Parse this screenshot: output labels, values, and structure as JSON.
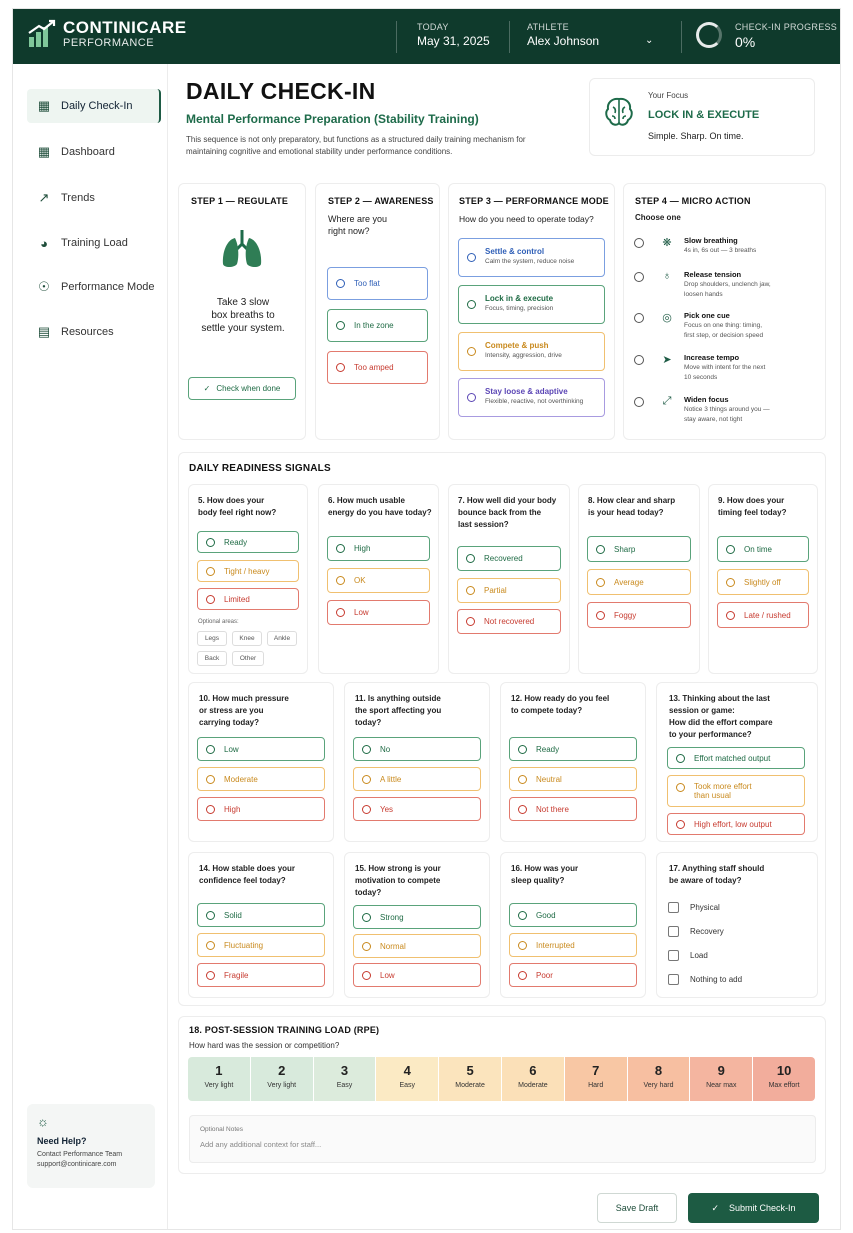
{
  "header": {
    "brand_line1": "CONTINICARE",
    "brand_line2": "PERFORMANCE",
    "today_label": "TODAY",
    "today_value": "May 31, 2025",
    "athlete_label": "ATHLETE",
    "athlete_value": "Alex Johnson",
    "progress_label": "CHECK-IN PROGRESS",
    "progress_value": "0%",
    "progress_fraction": 0
  },
  "sidebar": {
    "items": [
      {
        "label": "Daily Check-In",
        "icon": "checkin-icon"
      },
      {
        "label": "Dashboard",
        "icon": "dashboard-icon"
      },
      {
        "label": "Trends",
        "icon": "trends-icon"
      },
      {
        "label": "Training Load",
        "icon": "training-load-icon"
      },
      {
        "label": "Performance Mode",
        "icon": "performance-mode-icon"
      },
      {
        "label": "Resources",
        "icon": "resources-icon"
      }
    ],
    "help": {
      "title": "Need Help?",
      "line1": "Contact Performance Team",
      "line2": "support@continicare.com"
    }
  },
  "page": {
    "title": "DAILY CHECK-IN",
    "subtitle": "Mental Performance Preparation (Stability Training)",
    "description": "This sequence is not only preparatory, but functions as a structured daily training mechanism for maintaining cognitive and emotional stability under performance conditions."
  },
  "focus": {
    "label": "Your Focus",
    "value": "LOCK IN & EXECUTE",
    "tagline": "Simple. Sharp. On time."
  },
  "step1": {
    "title": "STEP 1 — REGULATE",
    "instruction_1": "Take 3 slow",
    "instruction_2": "box breaths to",
    "instruction_3": "settle your system.",
    "button": "Check when done"
  },
  "step2": {
    "title": "STEP 2 — AWARENESS",
    "question_1": "Where are you",
    "question_2": "right now?",
    "options": [
      "Too flat",
      "In the zone",
      "Too amped"
    ]
  },
  "step3": {
    "title": "STEP 3 — PERFORMANCE MODE",
    "question": "How do you need to operate today?",
    "options": [
      {
        "label": "Settle & control",
        "desc": "Calm the system, reduce noise"
      },
      {
        "label": "Lock in & execute",
        "desc": "Focus, timing, precision"
      },
      {
        "label": "Compete & push",
        "desc": "Intensity, aggression, drive"
      },
      {
        "label": "Stay loose & adaptive",
        "desc": "Flexible, reactive, not overthinking"
      }
    ]
  },
  "step4": {
    "title": "STEP 4 — MICRO ACTION",
    "subtitle": "Choose one",
    "options": [
      {
        "label": "Slow breathing",
        "desc1": "4s in, 6s out — 3 breaths",
        "desc2": "",
        "icon": "breathing-icon"
      },
      {
        "label": "Release tension",
        "desc1": "Drop shoulders, unclench jaw,",
        "desc2": "loosen hands",
        "icon": "release-icon"
      },
      {
        "label": "Pick one cue",
        "desc1": "Focus on one thing: timing,",
        "desc2": "first step, or decision speed",
        "icon": "target-icon"
      },
      {
        "label": "Increase tempo",
        "desc1": "Move with intent for the next",
        "desc2": "10 seconds",
        "icon": "runner-icon"
      },
      {
        "label": "Widen focus",
        "desc1": "Notice 3 things around you —",
        "desc2": "stay aware, not tight",
        "icon": "expand-icon"
      }
    ]
  },
  "readiness": {
    "title": "DAILY READINESS SIGNALS",
    "optional_areas_label": "Optional areas:",
    "areas": [
      "Legs",
      "Knee",
      "Ankle",
      "Back",
      "Other"
    ],
    "questions": [
      {
        "l1": "5. How does your",
        "l2": "body feel right now?",
        "l3": "",
        "options": [
          "Ready",
          "Tight / heavy",
          "Limited"
        ]
      },
      {
        "l1": "6. How much usable",
        "l2": "energy do you have today?",
        "l3": "",
        "options": [
          "High",
          "OK",
          "Low"
        ]
      },
      {
        "l1": "7. How well did your body",
        "l2": "bounce back from the",
        "l3": "last session?",
        "options": [
          "Recovered",
          "Partial",
          "Not recovered"
        ]
      },
      {
        "l1": "8. How clear and sharp",
        "l2": "is your head today?",
        "l3": "",
        "options": [
          "Sharp",
          "Average",
          "Foggy"
        ]
      },
      {
        "l1": "9. How does your",
        "l2": "timing feel today?",
        "l3": "",
        "options": [
          "On time",
          "Slightly off",
          "Late / rushed"
        ]
      },
      {
        "l1": "10. How much pressure",
        "l2": "or stress are you",
        "l3": "carrying today?",
        "options": [
          "Low",
          "Moderate",
          "High"
        ]
      },
      {
        "l1": "11. Is anything outside",
        "l2": "the sport affecting you",
        "l3": "today?",
        "options": [
          "No",
          "A little",
          "Yes"
        ]
      },
      {
        "l1": "12. How ready do you feel",
        "l2": "to compete today?",
        "l3": "",
        "options": [
          "Ready",
          "Neutral",
          "Not there"
        ]
      },
      {
        "l1": "13. Thinking about the last",
        "l2": "session or game:",
        "l3": "How did the effort compare",
        "l4": "to your performance?",
        "options": [
          "Effort matched output",
          "Took more effort",
          "than usual",
          "High effort, low output"
        ]
      },
      {
        "l1": "14. How stable does your",
        "l2": "confidence feel today?",
        "l3": "",
        "options": [
          "Solid",
          "Fluctuating",
          "Fragile"
        ]
      },
      {
        "l1": "15. How strong is your",
        "l2": "motivation to compete",
        "l3": "today?",
        "options": [
          "Strong",
          "Normal",
          "Low"
        ]
      },
      {
        "l1": "16. How was your",
        "l2": "sleep quality?",
        "l3": "",
        "options": [
          "Good",
          "Interrupted",
          "Poor"
        ]
      },
      {
        "l1": "17. Anything staff should",
        "l2": "be aware of today?",
        "l3": "",
        "options": [
          "Physical",
          "Recovery",
          "Load",
          "Nothing to add"
        ]
      }
    ]
  },
  "rpe": {
    "title": "18. POST-SESSION TRAINING LOAD (RPE)",
    "question": "How hard was the session or competition?",
    "scale": [
      {
        "n": "1",
        "w": "Very light",
        "color": "#d8eadc"
      },
      {
        "n": "2",
        "w": "Very light",
        "color": "#d8eadc"
      },
      {
        "n": "3",
        "w": "Easy",
        "color": "#dcebdc"
      },
      {
        "n": "4",
        "w": "Easy",
        "color": "#fbeac4"
      },
      {
        "n": "5",
        "w": "Moderate",
        "color": "#fbe4bd"
      },
      {
        "n": "6",
        "w": "Moderate",
        "color": "#fbe0b8"
      },
      {
        "n": "7",
        "w": "Hard",
        "color": "#f8c7a4"
      },
      {
        "n": "8",
        "w": "Very hard",
        "color": "#f7bfa1"
      },
      {
        "n": "9",
        "w": "Near max",
        "color": "#f4b5a0"
      },
      {
        "n": "10",
        "w": "Max effort",
        "color": "#f2ad9c"
      }
    ],
    "notes_label": "Optional Notes",
    "notes_placeholder": "Add any additional context for staff..."
  },
  "actions": {
    "save": "Save Draft",
    "submit": "Submit Check-In"
  },
  "colors": {
    "brand": "#0f3a2c",
    "accent": "#1e6b4a"
  }
}
